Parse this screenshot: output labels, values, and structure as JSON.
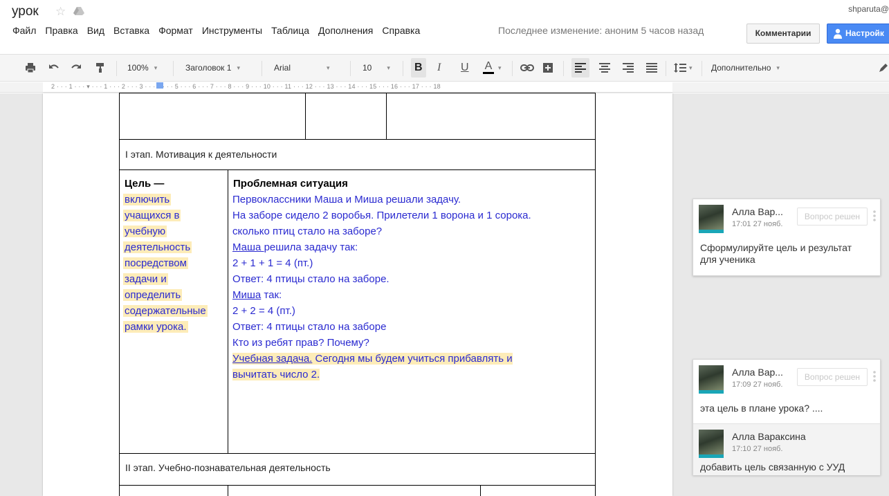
{
  "header": {
    "title": "урок",
    "user_email": "shparuta@",
    "menu": [
      "Файл",
      "Правка",
      "Вид",
      "Вставка",
      "Формат",
      "Инструменты",
      "Таблица",
      "Дополнения",
      "Справка"
    ],
    "last_edit": "Последнее изменение: аноним 5 часов назад",
    "comments_label": "Комментарии",
    "settings_label": "Настройк"
  },
  "toolbar": {
    "zoom": "100%",
    "style": "Заголовок 1",
    "font": "Arial",
    "font_size": "10",
    "bold": "B",
    "italic": "I",
    "underline": "U",
    "text_color": "A",
    "more": "Дополнительно"
  },
  "ruler": {
    "numbers": "2 · · · 1 · · · ▾ · · · 1 · · · 2 · · · 3 · · · 4 · · · 5 · · · 6 · · · 7 · · · 8 · · · 9 · · · 10 · · · 11 · · · 12 · · · 13 · · · 14 · · · 15 · · · 16 · · · 17 · · · 18"
  },
  "document": {
    "stage1": "I этап. Мотивация к деятельности",
    "goal_heading": "Цель —",
    "goal_lines": [
      "включить",
      "учащихся в",
      "учебную",
      "деятельность",
      "посредством",
      "задачи и",
      "определить",
      "содержательные",
      "рамки урока."
    ],
    "problem_heading": "Проблемная ситуация",
    "problem": {
      "l1": "Первоклассники Маша и Миша решали задачу.",
      "l2": "На заборе сидело 2 воробья. Прилетели 1 ворона и 1 сорока.",
      "l3": "сколько птиц стало на заборе?",
      "l4_name": "Маша ",
      "l4_rest": "решила задачу так:",
      "l5": "2 + 1 + 1 = 4 (пт.)",
      "l6": "Ответ: 4 птицы стало на заборе.",
      "l7_name": "Миша",
      "l7_rest": " так:",
      "l8": "2 + 2 = 4 (пт.)",
      "l9": "Ответ: 4 птицы стало на заборе",
      "l10": "Кто из ребят прав? Почему?",
      "l11_link": "Учебная задача.",
      "l11_rest": " Сегодня мы будем учиться прибавлять и",
      "l12": "вычитать число 2."
    },
    "stage2": "II этап. Учебно-познавательная деятельность"
  },
  "comments": [
    {
      "author": "Алла Вар...",
      "time": "17:01 27 нояб.",
      "resolve": "Вопрос решен",
      "text_line1": "Сформулируйте цель и результат",
      "text_line2": "для ученика"
    },
    {
      "author": "Алла Вар...",
      "time": "17:09 27 нояб.",
      "resolve": "Вопрос решен",
      "text_line1": "эта цель в плане урока? ...."
    },
    {
      "author": "Алла Вараксина",
      "time": "17:10 27 нояб.",
      "text_line1": "добавить цель связанную с УУД"
    }
  ],
  "colors": {
    "highlight": "#fdecb8",
    "text_blue": "#2a2ad0",
    "accent": "#4a8af4",
    "avatar_strip": "#1aa6b7"
  }
}
